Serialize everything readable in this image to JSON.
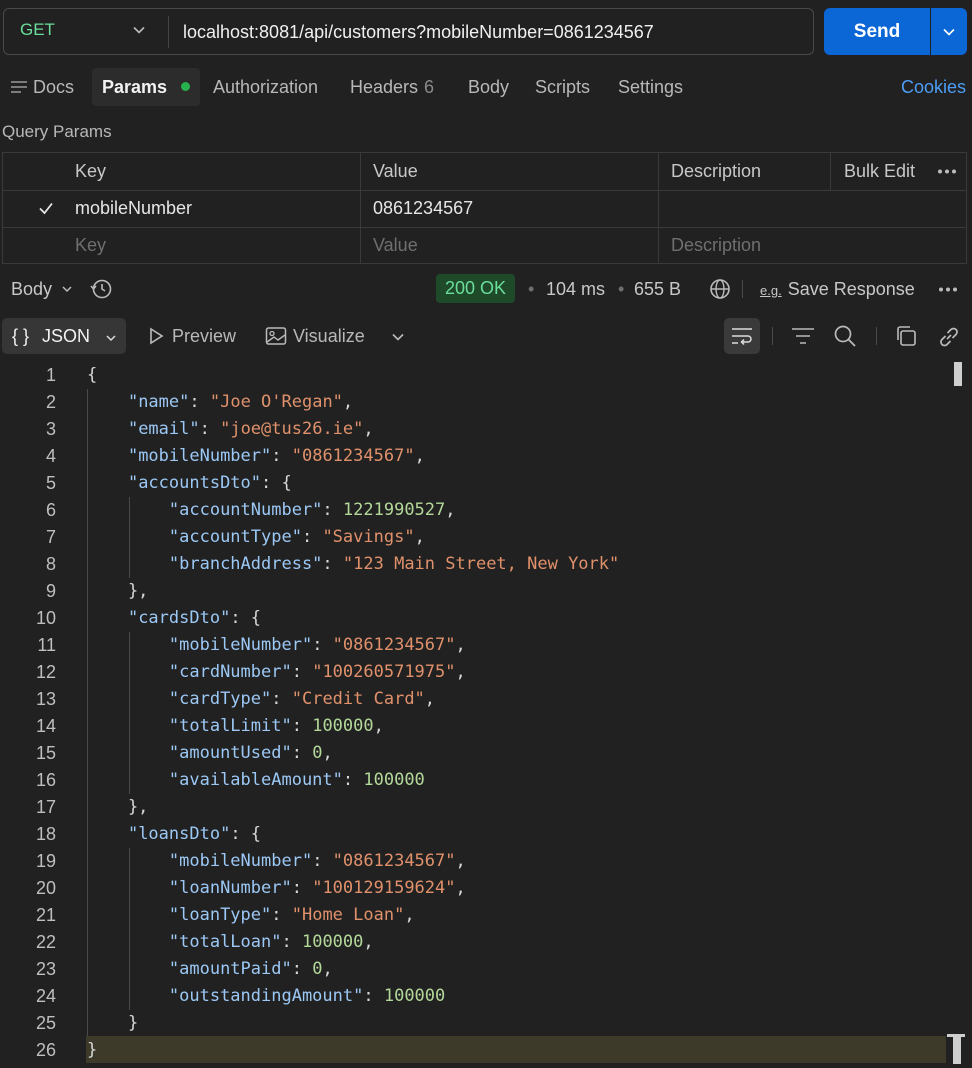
{
  "request": {
    "method": "GET",
    "url": "localhost:8081/api/customers?mobileNumber=0861234567",
    "send_label": "Send"
  },
  "tabs": [
    {
      "label": "Docs"
    },
    {
      "label": "Params"
    },
    {
      "label": "Authorization"
    },
    {
      "label": "Headers",
      "count": "6"
    },
    {
      "label": "Body"
    },
    {
      "label": "Scripts"
    },
    {
      "label": "Settings"
    }
  ],
  "cookies_label": "Cookies",
  "query_params": {
    "title": "Query Params",
    "headers": {
      "key": "Key",
      "value": "Value",
      "description": "Description",
      "bulk_edit": "Bulk Edit"
    },
    "rows": [
      {
        "key": "mobileNumber",
        "value": "0861234567",
        "description": "",
        "checked": true
      }
    ],
    "placeholder": {
      "key": "Key",
      "value": "Value",
      "description": "Description"
    }
  },
  "response": {
    "body_label": "Body",
    "status": "200 OK",
    "time": "104 ms",
    "size": "655 B",
    "eg_label": "e.g.",
    "save_label": "Save Response",
    "format_label": "JSON",
    "preview_label": "Preview",
    "visualize_label": "Visualize"
  },
  "code_lines": [
    {
      "n": "1",
      "tokens": [
        {
          "t": "pun",
          "v": "{"
        }
      ]
    },
    {
      "n": "2",
      "tokens": [
        {
          "t": "pun",
          "v": "    "
        },
        {
          "t": "key",
          "v": "\"name\""
        },
        {
          "t": "pun",
          "v": ": "
        },
        {
          "t": "str",
          "v": "\"Joe O'Regan\""
        },
        {
          "t": "pun",
          "v": ","
        }
      ]
    },
    {
      "n": "3",
      "tokens": [
        {
          "t": "pun",
          "v": "    "
        },
        {
          "t": "key",
          "v": "\"email\""
        },
        {
          "t": "pun",
          "v": ": "
        },
        {
          "t": "str",
          "v": "\"joe@tus26.ie\""
        },
        {
          "t": "pun",
          "v": ","
        }
      ]
    },
    {
      "n": "4",
      "tokens": [
        {
          "t": "pun",
          "v": "    "
        },
        {
          "t": "key",
          "v": "\"mobileNumber\""
        },
        {
          "t": "pun",
          "v": ": "
        },
        {
          "t": "str",
          "v": "\"0861234567\""
        },
        {
          "t": "pun",
          "v": ","
        }
      ]
    },
    {
      "n": "5",
      "tokens": [
        {
          "t": "pun",
          "v": "    "
        },
        {
          "t": "key",
          "v": "\"accountsDto\""
        },
        {
          "t": "pun",
          "v": ": {"
        }
      ]
    },
    {
      "n": "6",
      "tokens": [
        {
          "t": "pun",
          "v": "        "
        },
        {
          "t": "key",
          "v": "\"accountNumber\""
        },
        {
          "t": "pun",
          "v": ": "
        },
        {
          "t": "num",
          "v": "1221990527"
        },
        {
          "t": "pun",
          "v": ","
        }
      ]
    },
    {
      "n": "7",
      "tokens": [
        {
          "t": "pun",
          "v": "        "
        },
        {
          "t": "key",
          "v": "\"accountType\""
        },
        {
          "t": "pun",
          "v": ": "
        },
        {
          "t": "str",
          "v": "\"Savings\""
        },
        {
          "t": "pun",
          "v": ","
        }
      ]
    },
    {
      "n": "8",
      "tokens": [
        {
          "t": "pun",
          "v": "        "
        },
        {
          "t": "key",
          "v": "\"branchAddress\""
        },
        {
          "t": "pun",
          "v": ": "
        },
        {
          "t": "str",
          "v": "\"123 Main Street, New York\""
        }
      ]
    },
    {
      "n": "9",
      "tokens": [
        {
          "t": "pun",
          "v": "    },"
        }
      ]
    },
    {
      "n": "10",
      "tokens": [
        {
          "t": "pun",
          "v": "    "
        },
        {
          "t": "key",
          "v": "\"cardsDto\""
        },
        {
          "t": "pun",
          "v": ": {"
        }
      ]
    },
    {
      "n": "11",
      "tokens": [
        {
          "t": "pun",
          "v": "        "
        },
        {
          "t": "key",
          "v": "\"mobileNumber\""
        },
        {
          "t": "pun",
          "v": ": "
        },
        {
          "t": "str",
          "v": "\"0861234567\""
        },
        {
          "t": "pun",
          "v": ","
        }
      ]
    },
    {
      "n": "12",
      "tokens": [
        {
          "t": "pun",
          "v": "        "
        },
        {
          "t": "key",
          "v": "\"cardNumber\""
        },
        {
          "t": "pun",
          "v": ": "
        },
        {
          "t": "str",
          "v": "\"100260571975\""
        },
        {
          "t": "pun",
          "v": ","
        }
      ]
    },
    {
      "n": "13",
      "tokens": [
        {
          "t": "pun",
          "v": "        "
        },
        {
          "t": "key",
          "v": "\"cardType\""
        },
        {
          "t": "pun",
          "v": ": "
        },
        {
          "t": "str",
          "v": "\"Credit Card\""
        },
        {
          "t": "pun",
          "v": ","
        }
      ]
    },
    {
      "n": "14",
      "tokens": [
        {
          "t": "pun",
          "v": "        "
        },
        {
          "t": "key",
          "v": "\"totalLimit\""
        },
        {
          "t": "pun",
          "v": ": "
        },
        {
          "t": "num",
          "v": "100000"
        },
        {
          "t": "pun",
          "v": ","
        }
      ]
    },
    {
      "n": "15",
      "tokens": [
        {
          "t": "pun",
          "v": "        "
        },
        {
          "t": "key",
          "v": "\"amountUsed\""
        },
        {
          "t": "pun",
          "v": ": "
        },
        {
          "t": "num",
          "v": "0"
        },
        {
          "t": "pun",
          "v": ","
        }
      ]
    },
    {
      "n": "16",
      "tokens": [
        {
          "t": "pun",
          "v": "        "
        },
        {
          "t": "key",
          "v": "\"availableAmount\""
        },
        {
          "t": "pun",
          "v": ": "
        },
        {
          "t": "num",
          "v": "100000"
        }
      ]
    },
    {
      "n": "17",
      "tokens": [
        {
          "t": "pun",
          "v": "    },"
        }
      ]
    },
    {
      "n": "18",
      "tokens": [
        {
          "t": "pun",
          "v": "    "
        },
        {
          "t": "key",
          "v": "\"loansDto\""
        },
        {
          "t": "pun",
          "v": ": {"
        }
      ]
    },
    {
      "n": "19",
      "tokens": [
        {
          "t": "pun",
          "v": "        "
        },
        {
          "t": "key",
          "v": "\"mobileNumber\""
        },
        {
          "t": "pun",
          "v": ": "
        },
        {
          "t": "str",
          "v": "\"0861234567\""
        },
        {
          "t": "pun",
          "v": ","
        }
      ]
    },
    {
      "n": "20",
      "tokens": [
        {
          "t": "pun",
          "v": "        "
        },
        {
          "t": "key",
          "v": "\"loanNumber\""
        },
        {
          "t": "pun",
          "v": ": "
        },
        {
          "t": "str",
          "v": "\"100129159624\""
        },
        {
          "t": "pun",
          "v": ","
        }
      ]
    },
    {
      "n": "21",
      "tokens": [
        {
          "t": "pun",
          "v": "        "
        },
        {
          "t": "key",
          "v": "\"loanType\""
        },
        {
          "t": "pun",
          "v": ": "
        },
        {
          "t": "str",
          "v": "\"Home Loan\""
        },
        {
          "t": "pun",
          "v": ","
        }
      ]
    },
    {
      "n": "22",
      "tokens": [
        {
          "t": "pun",
          "v": "        "
        },
        {
          "t": "key",
          "v": "\"totalLoan\""
        },
        {
          "t": "pun",
          "v": ": "
        },
        {
          "t": "num",
          "v": "100000"
        },
        {
          "t": "pun",
          "v": ","
        }
      ]
    },
    {
      "n": "23",
      "tokens": [
        {
          "t": "pun",
          "v": "        "
        },
        {
          "t": "key",
          "v": "\"amountPaid\""
        },
        {
          "t": "pun",
          "v": ": "
        },
        {
          "t": "num",
          "v": "0"
        },
        {
          "t": "pun",
          "v": ","
        }
      ]
    },
    {
      "n": "24",
      "tokens": [
        {
          "t": "pun",
          "v": "        "
        },
        {
          "t": "key",
          "v": "\"outstandingAmount\""
        },
        {
          "t": "pun",
          "v": ": "
        },
        {
          "t": "num",
          "v": "100000"
        }
      ]
    },
    {
      "n": "25",
      "tokens": [
        {
          "t": "pun",
          "v": "    }"
        }
      ]
    },
    {
      "n": "26",
      "tokens": [
        {
          "t": "pun",
          "v": "}"
        }
      ]
    }
  ],
  "colors": {
    "accent": "#0b66d6",
    "method": "#6bdd9a",
    "status_bg": "#1f4a2a",
    "key": "#9cc8f5",
    "string": "#e0916b",
    "number": "#b3d89a"
  }
}
